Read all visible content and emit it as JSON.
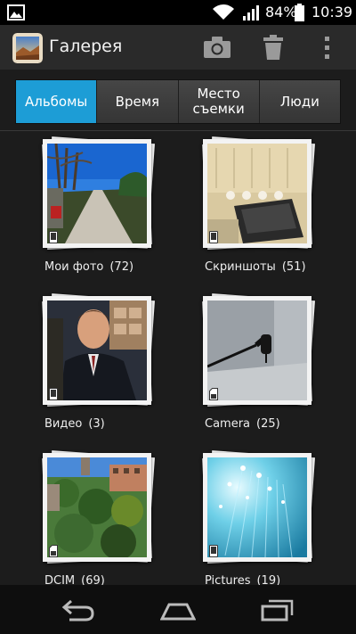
{
  "status_bar": {
    "battery_percent": "84%",
    "time": "10:39",
    "icons": [
      "image-notification-icon",
      "wifi-icon",
      "signal-icon",
      "battery-icon"
    ]
  },
  "action_bar": {
    "title": "Галерея",
    "icons": [
      "gallery-app-icon",
      "camera-icon",
      "trash-icon",
      "overflow-menu-icon"
    ]
  },
  "tabs": [
    {
      "label": "Альбомы",
      "active": true
    },
    {
      "label": "Время",
      "active": false
    },
    {
      "label": "Место\nсъемки",
      "active": false
    },
    {
      "label": "Люди",
      "active": false
    }
  ],
  "albums": [
    {
      "name": "Мои фото",
      "count": "(72)",
      "type_icon": "phone-icon"
    },
    {
      "name": "Скриншоты",
      "count": "(51)",
      "type_icon": "phone-icon"
    },
    {
      "name": "Видео",
      "count": "(3)",
      "type_icon": "phone-icon"
    },
    {
      "name": "Camera",
      "count": "(25)",
      "type_icon": "sd-card-icon"
    },
    {
      "name": "DCIM",
      "count": "(69)",
      "type_icon": "sd-card-icon"
    },
    {
      "name": "Pictures",
      "count": "(19)",
      "type_icon": "phone-icon"
    }
  ],
  "nav_bar": {
    "icons": [
      "back-icon",
      "home-icon",
      "recents-icon"
    ]
  },
  "colors": {
    "accent": "#1d9dd6",
    "background": "#1c1c1c",
    "action_bar": "#2a2a2a",
    "nav_bar": "#0e0e0e"
  }
}
